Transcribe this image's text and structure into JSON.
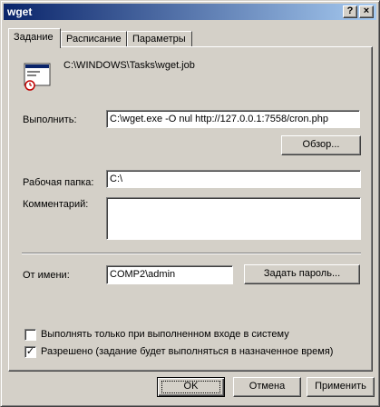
{
  "window": {
    "title": "wget",
    "help_glyph": "?",
    "close_glyph": "×"
  },
  "tabs": [
    {
      "label": "Задание"
    },
    {
      "label": "Расписание"
    },
    {
      "label": "Параметры"
    }
  ],
  "task": {
    "path": "C:\\WINDOWS\\Tasks\\wget.job",
    "run_label": "Выполнить:",
    "run_value": "C:\\wget.exe -O nul http://127.0.0.1:7558/cron.php",
    "browse_button": "Обзор...",
    "workdir_label": "Рабочая папка:",
    "workdir_value": "C:\\",
    "comment_label": "Комментарий:",
    "comment_value": "",
    "runas_label": "От имени:",
    "runas_value": "COMP2\\admin",
    "set_password_button": "Задать пароль...",
    "only_logged_on": {
      "label": "Выполнять только при выполненном входе в систему",
      "checked": false
    },
    "enabled": {
      "label": "Разрешено (задание будет выполняться в назначенное время)",
      "checked": true,
      "check_glyph": "✓"
    }
  },
  "footer": {
    "ok": "OK",
    "cancel": "Отмена",
    "apply": "Применить"
  }
}
